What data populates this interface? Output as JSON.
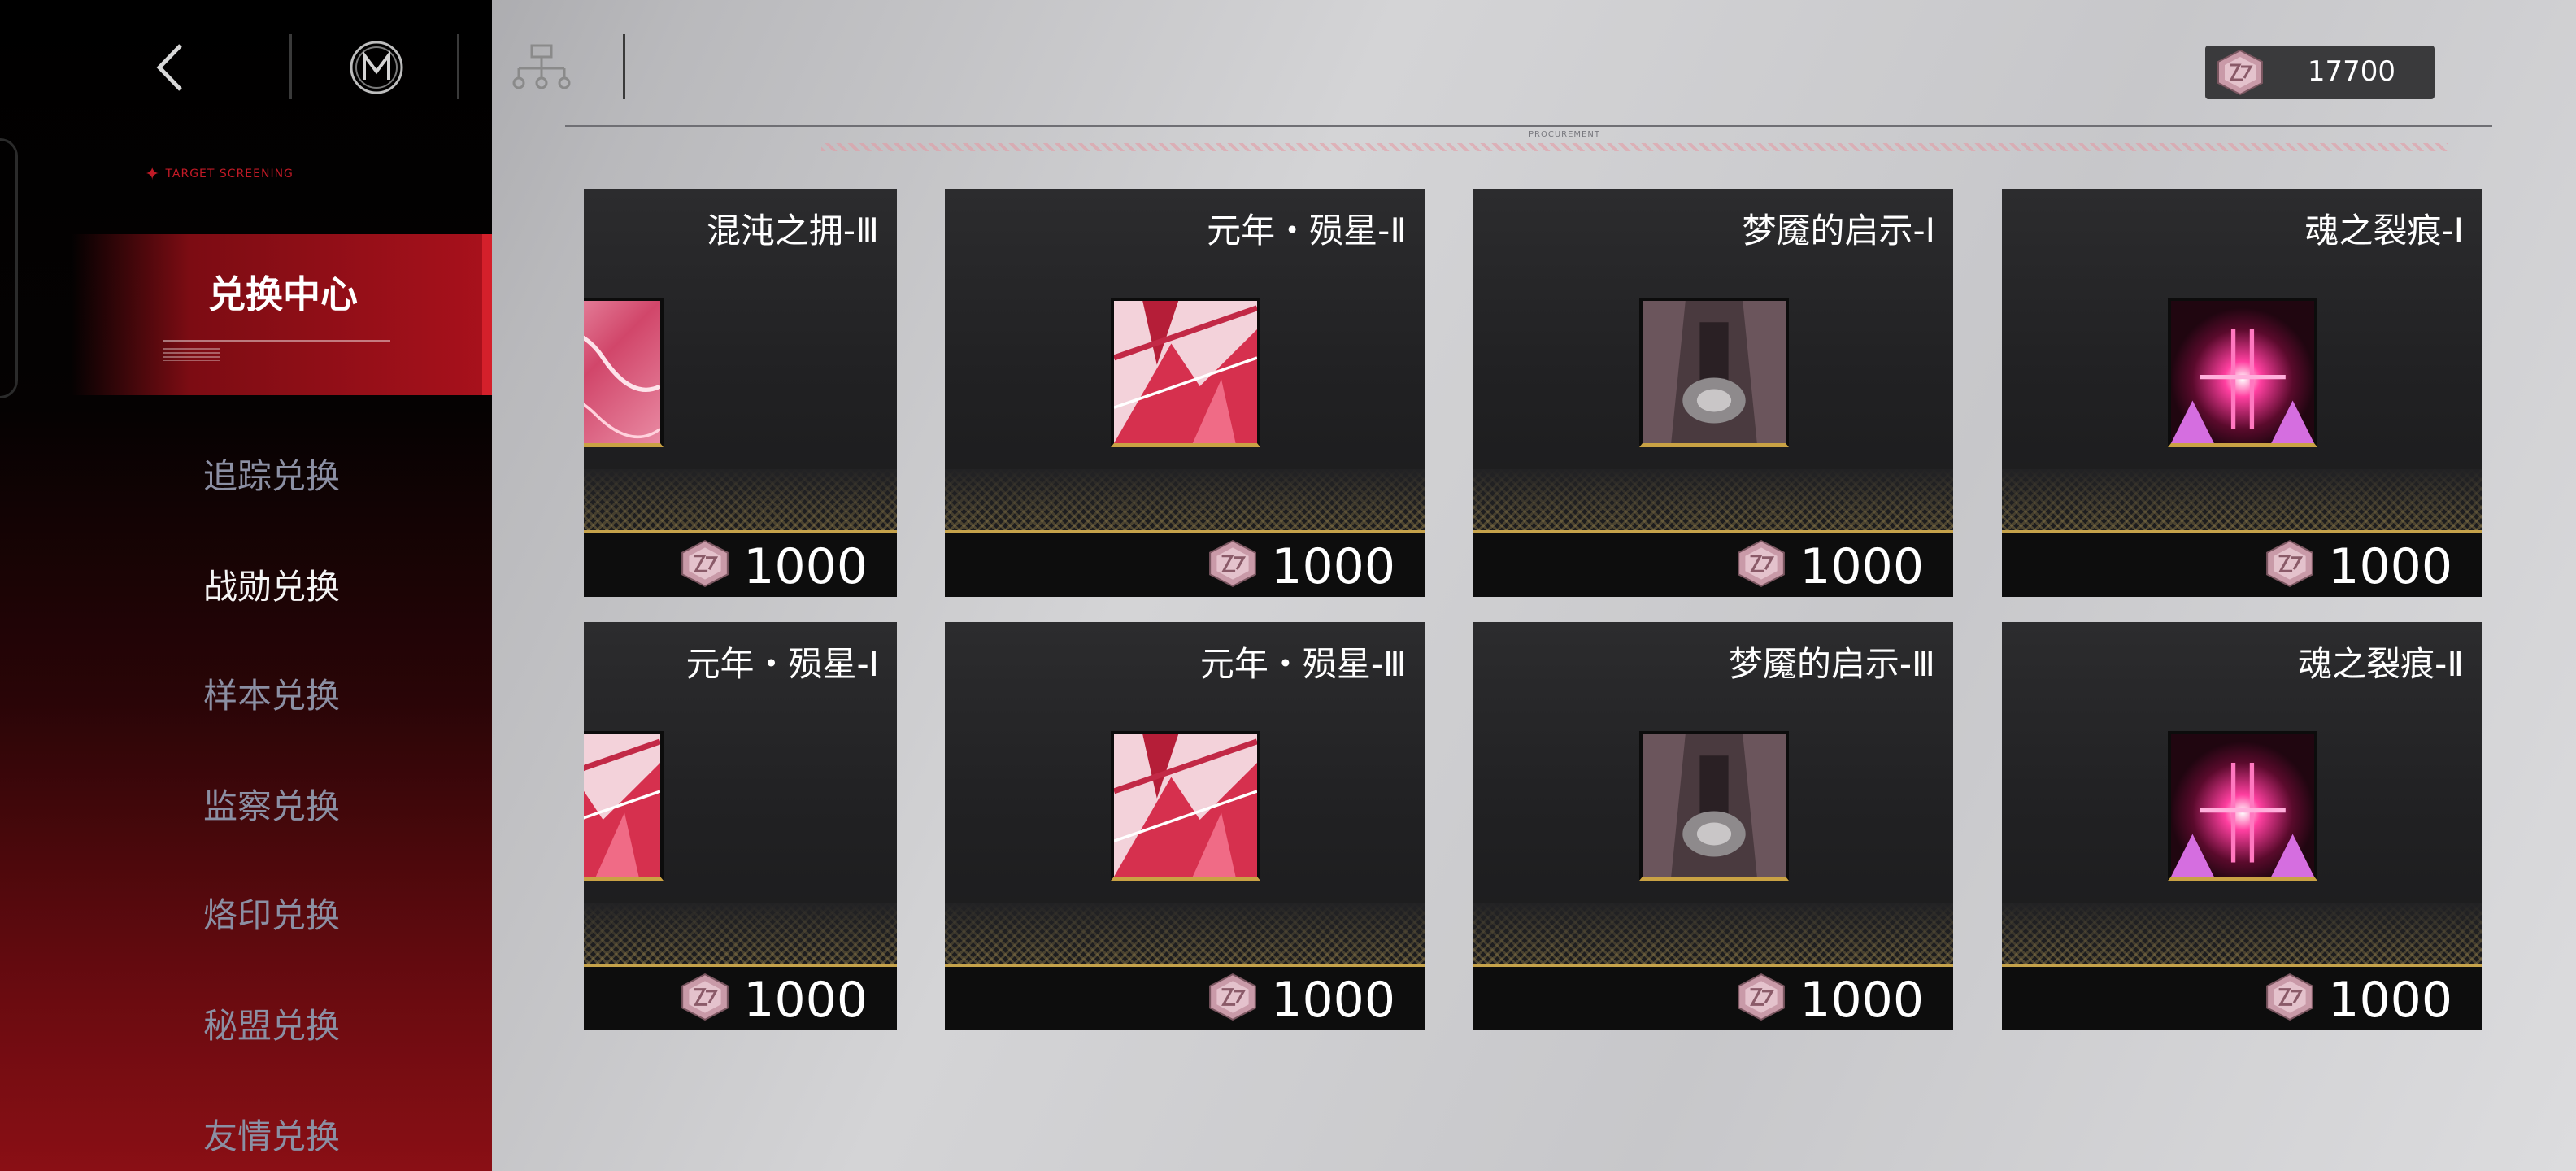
{
  "sidebar": {
    "target_tag": "TARGET SCREENING",
    "active_tab": "兑换中心",
    "items": [
      {
        "label": "追踪兑换"
      },
      {
        "label": "战勋兑换"
      },
      {
        "label": "样本兑换"
      },
      {
        "label": "监察兑换"
      },
      {
        "label": "烙印兑换"
      },
      {
        "label": "秘盟兑换"
      },
      {
        "label": "友情兑换"
      }
    ],
    "current_item": "战勋兑换"
  },
  "header": {
    "currency_value": "17700",
    "rule_center": "PROCUREMENT"
  },
  "icons": {
    "back": "back-arrow-icon",
    "logo": "m-emblem-icon",
    "tree": "hierarchy-icon",
    "currency": "medal-currency-icon"
  },
  "colors": {
    "accent_red": "#a9111c",
    "gold_line": "#c5a24a",
    "nav_inactive": "#8b8fa3"
  },
  "cards": [
    {
      "title": "混沌之拥-Ⅲ",
      "price": "1000",
      "art": "pink-fabric"
    },
    {
      "title": "元年・殒星-Ⅱ",
      "price": "1000",
      "art": "red-shards"
    },
    {
      "title": "梦魇的启示-Ⅰ",
      "price": "1000",
      "art": "dark-figure"
    },
    {
      "title": "魂之裂痕-Ⅰ",
      "price": "1000",
      "art": "magenta-glow"
    },
    {
      "title": "元年・殒星-Ⅰ",
      "price": "1000",
      "art": "red-shards"
    },
    {
      "title": "元年・殒星-Ⅲ",
      "price": "1000",
      "art": "red-shards"
    },
    {
      "title": "梦魇的启示-Ⅲ",
      "price": "1000",
      "art": "dark-figure"
    },
    {
      "title": "魂之裂痕-Ⅱ",
      "price": "1000",
      "art": "magenta-glow"
    }
  ]
}
